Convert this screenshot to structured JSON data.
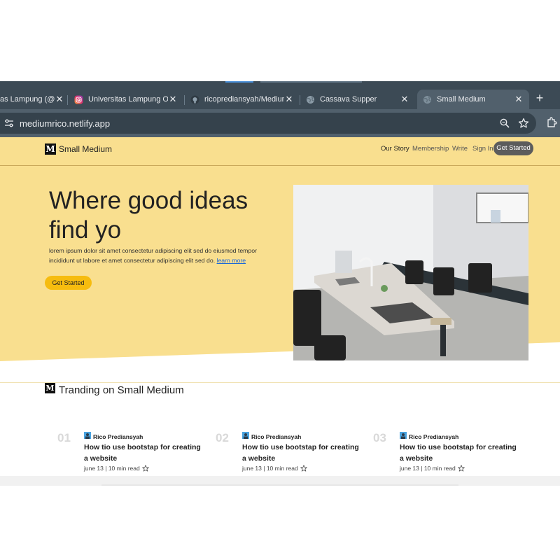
{
  "browser": {
    "tabs": [
      {
        "title": "as Lampung (@u",
        "favicon": "globe-icon"
      },
      {
        "title": "Universitas Lampung Offi",
        "favicon": "instagram-icon"
      },
      {
        "title": "ricoprediansyah/Medium",
        "favicon": "github-icon"
      },
      {
        "title": "Cassava Supper",
        "favicon": "globe-icon"
      },
      {
        "title": "Small Medium",
        "favicon": "globe-icon",
        "active": true
      }
    ],
    "new_tab": "+",
    "url": "mediumrico.netlify.app"
  },
  "site": {
    "logo_letter": "M",
    "brand": "Small Medium",
    "nav": {
      "our_story": "Our Story",
      "membership": "Membership",
      "write": "Write",
      "sign_in": "Sign In",
      "cta": "Get Started"
    },
    "hero": {
      "title": "Where good ideas find yo",
      "text": "lorem ipsum dolor sit amet consectetur adipiscing elit sed do eiusmod tempor incididunt ut labore et amet consectetur adipiscing elit sed do.",
      "link": "learn more",
      "cta": "Get Started"
    },
    "trending": {
      "title": "Tranding on Small Medium",
      "cards": [
        {
          "num": "01",
          "author": "Rico Prediansyah",
          "title": "How tio use bootstap for creating a website",
          "meta": "june 13 | 10 min read"
        },
        {
          "num": "02",
          "author": "Rico Prediansyah",
          "title": "How tio use bootstap for creating a website",
          "meta": "june 13 | 10 min read"
        },
        {
          "num": "03",
          "author": "Rico Prediansyah",
          "title": "How tio use bootstap for creating a website",
          "meta": "june 13 | 10 min read"
        }
      ]
    }
  },
  "colors": {
    "hero_yellow": "#f9df8f",
    "cta_yellow": "#f6bc0f",
    "chrome_dark": "#3c4a55",
    "chrome_toolbar": "#51606c"
  }
}
